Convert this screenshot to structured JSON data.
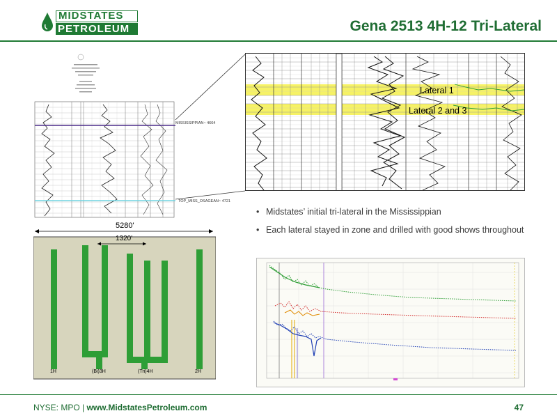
{
  "header": {
    "logo_line1": "MIDSTATES",
    "logo_line2": "PETROLEUM",
    "title": "Gena 2513 4H-12 Tri-Lateral"
  },
  "small_log": {
    "marker_top": "MISSISSIPPIAN~ 4664",
    "marker_bottom": "TOP_MISS_OSAGEAN~ 4721"
  },
  "big_log": {
    "lateral1": "Lateral 1",
    "lateral23": "Lateral 2 and 3"
  },
  "plat": {
    "width_label": "5280'",
    "spacing_label": "1320'",
    "wells": [
      "1H",
      "(Bi)3H",
      "(Tri)4H",
      "2H"
    ]
  },
  "bullets": [
    "Midstates’ initial tri-lateral  in the Mississippian",
    "Each lateral stayed in zone and drilled with good shows throughout"
  ],
  "footer": {
    "prefix": "NYSE: MPO | ",
    "site": "www.MidstatesPetroleum.com",
    "page": "47"
  },
  "colors": {
    "brand_green": "#1f7a34",
    "lateral_green": "#2e9e36",
    "highlight_yellow": "#f4f04a"
  }
}
